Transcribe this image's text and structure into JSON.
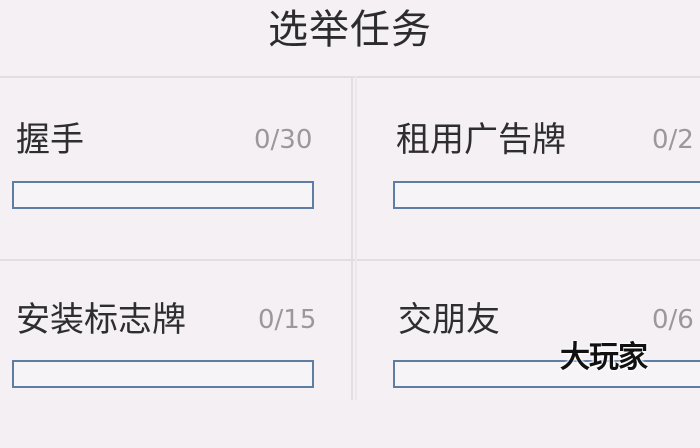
{
  "title": "选举任务",
  "tasks": [
    {
      "name": "握手",
      "count": "0/30",
      "progress": 0
    },
    {
      "name": "租用广告牌",
      "count": "0/2",
      "progress": 0
    },
    {
      "name": "安装标志牌",
      "count": "0/15",
      "progress": 0
    },
    {
      "name": "交朋友",
      "count": "0/6",
      "progress": 0
    }
  ],
  "watermark": "大玩家",
  "colors": {
    "background": "#f4f0f4",
    "bar_border": "#5e7da4",
    "divider": "#e1dde2",
    "count_text": "#9b979c"
  }
}
